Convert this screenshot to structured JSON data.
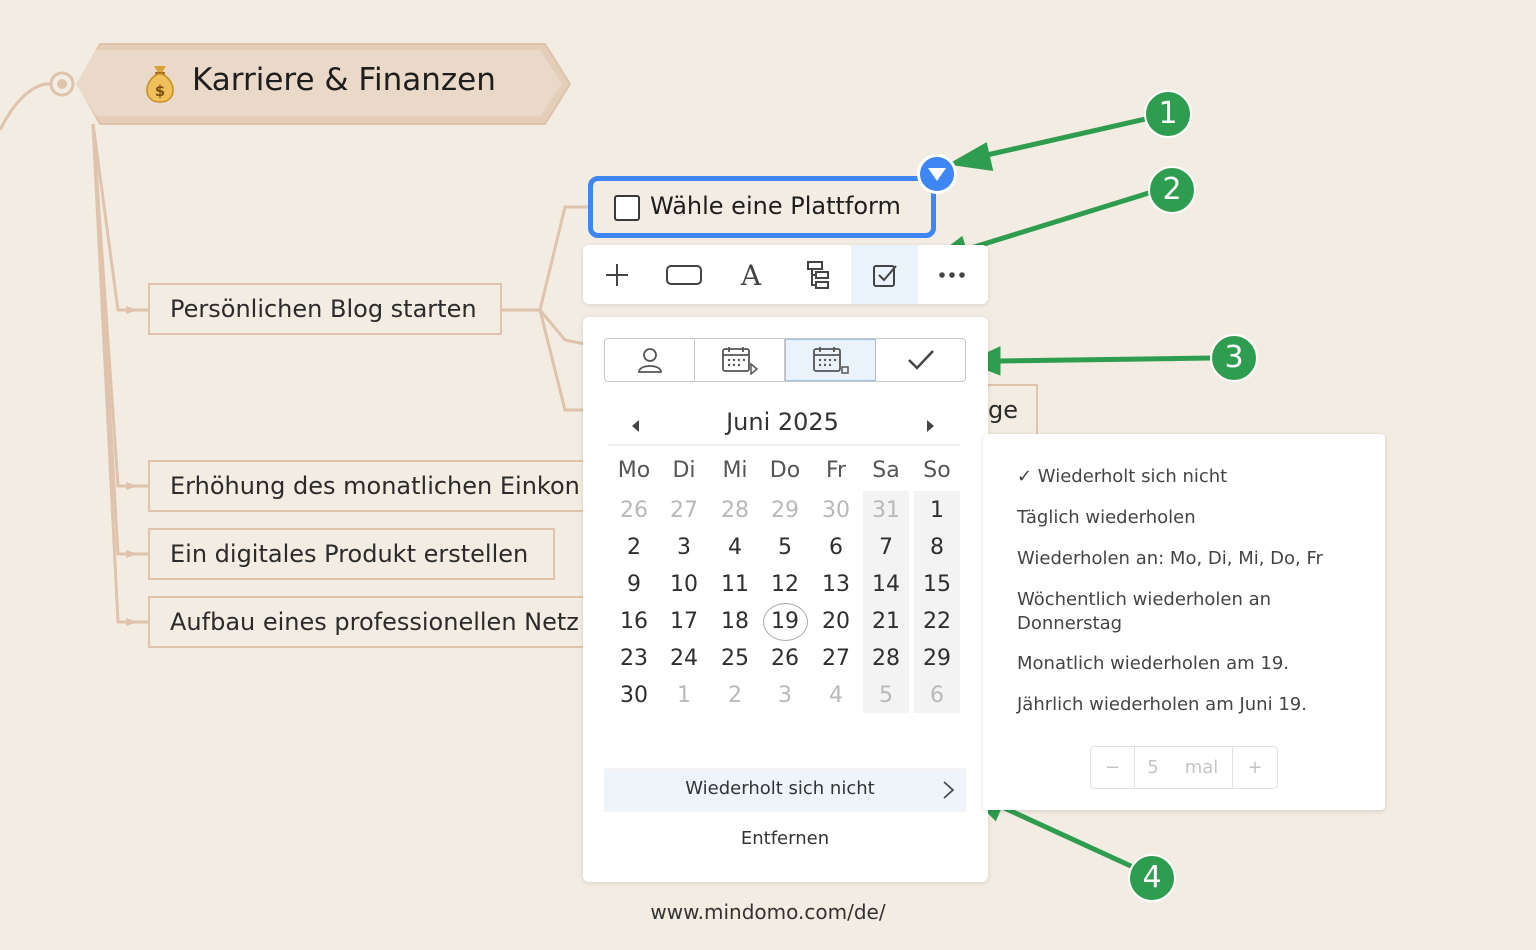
{
  "mindmap": {
    "root_title": "Karriere & Finanzen",
    "root_icon": "money-bag-icon",
    "branches": [
      "Persönlichen Blog starten",
      "Erhöhung des monatlichen Einkon",
      "Ein digitales Produkt erstellen",
      "Aufbau eines professionellen Netz"
    ],
    "hidden_topic_fragment": "ge",
    "selected_task": "Wähle eine Plattform"
  },
  "toolbar": {
    "items": [
      "add-icon",
      "shape-icon",
      "text-format-icon",
      "structure-icon",
      "task-icon",
      "more-icon"
    ],
    "active": "task-icon"
  },
  "task_panel": {
    "tabs": [
      "person-icon",
      "start-date-icon",
      "due-date-icon",
      "complete-icon"
    ],
    "active_tab": "due-date-icon",
    "month": "Juni 2025",
    "weekdays": [
      "Mo",
      "Di",
      "Mi",
      "Do",
      "Fr",
      "Sa",
      "So"
    ],
    "weeks": [
      [
        "26",
        "27",
        "28",
        "29",
        "30",
        "31",
        "1"
      ],
      [
        "2",
        "3",
        "4",
        "5",
        "6",
        "7",
        "8"
      ],
      [
        "9",
        "10",
        "11",
        "12",
        "13",
        "14",
        "15"
      ],
      [
        "16",
        "17",
        "18",
        "19",
        "20",
        "21",
        "22"
      ],
      [
        "23",
        "24",
        "25",
        "26",
        "27",
        "28",
        "29"
      ],
      [
        "30",
        "1",
        "2",
        "3",
        "4",
        "5",
        "6"
      ]
    ],
    "today": "19",
    "repeat_label": "Wiederholt sich nicht",
    "remove_label": "Entfernen"
  },
  "repeat_menu": {
    "options": [
      "✓ Wiederholt sich nicht",
      "Täglich wiederholen",
      "Wiederholen an: Mo, Di, Mi, Do, Fr",
      "Wöchentlich wiederholen an Donnerstag",
      "Monatlich wiederholen am 19.",
      "Jährlich wiederholen am Juni 19."
    ],
    "count_minus": "−",
    "count_value": "5",
    "count_unit": "mal",
    "count_plus": "+"
  },
  "callouts": [
    "1",
    "2",
    "3",
    "4"
  ],
  "footer": {
    "url": "www.mindomo.com/de/"
  },
  "colors": {
    "background": "#f3ece2",
    "selection": "#3d86f4",
    "callout": "#2f9d4f",
    "topic_border": "#dfc3ad"
  }
}
